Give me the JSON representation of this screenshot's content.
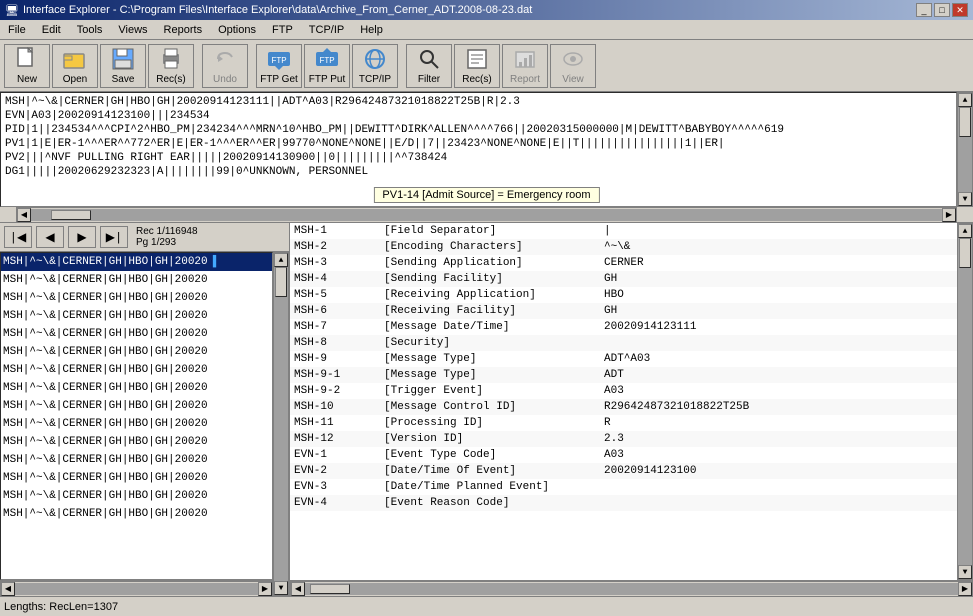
{
  "window": {
    "title": "Interface Explorer - C:\\Program Files\\Interface Explorer\\data\\Archive_From_Cerner_ADT.2008-08-23.dat",
    "icon": "🖥"
  },
  "menu": {
    "items": [
      "File",
      "Edit",
      "Tools",
      "Views",
      "Reports",
      "Options",
      "FTP",
      "TCP/IP",
      "Help"
    ]
  },
  "toolbar": {
    "buttons": [
      {
        "label": "New",
        "icon": "📄",
        "name": "new-button"
      },
      {
        "label": "Open",
        "icon": "📂",
        "name": "open-button"
      },
      {
        "label": "Save",
        "icon": "💾",
        "name": "save-button"
      },
      {
        "label": "Rec(s)",
        "icon": "🖨",
        "name": "recs-print-button"
      },
      {
        "label": "Undo",
        "icon": "↩",
        "name": "undo-button",
        "disabled": true
      },
      {
        "label": "FTP Get",
        "icon": "⬇",
        "name": "ftp-get-button"
      },
      {
        "label": "FTP Put",
        "icon": "⬆",
        "name": "ftp-put-button"
      },
      {
        "label": "TCP/IP",
        "icon": "🌐",
        "name": "tcpip-button"
      },
      {
        "label": "Filter",
        "icon": "🔍",
        "name": "filter-button"
      },
      {
        "label": "Rec(s)",
        "icon": "📋",
        "name": "recs-button"
      },
      {
        "label": "Report",
        "icon": "📊",
        "name": "report-button",
        "disabled": true
      },
      {
        "label": "View",
        "icon": "👁",
        "name": "view-button",
        "disabled": true
      }
    ]
  },
  "text_area": {
    "lines": [
      "MSH|^~\\&|CERNER|GH|HBO|GH|20020914123111||ADT^A03|R29642487321018822T25B|R|2.3",
      "EVN|A03|20020914123100|||234534",
      "PID|1||234534^^^CPI^2^HBO_PM|234234^^^MRN^10^HBO_PM||DEWITT^DIRK^ALLEN^^^^766||20020315000000|M|DEWITT^BABYBOY^^^^^619",
      "PV1|1|E|ER-1^^^ER^^772^ER|E|ER-1^^^ER^^ER|99770^NONE^NONE||E/D||7||23423^NONE^NONE|E||T||||||||||||||||1||ER|",
      "PV2|||^NVF PULLING RIGHT EAR|||||20020914130900||0|||||||||^^738424",
      "DG1|||||20020629232323|A||||||||99|0^UNKNOWN, PERSONNEL"
    ],
    "tooltip": "PV1-14 [Admit Source] = Emergency room"
  },
  "nav": {
    "record_info": "Rec 1/116948",
    "page_info": "Pg 1/293"
  },
  "record_list": {
    "items": [
      "MSH|^~\\&|CERNER|GH|HBO|GH|20020",
      "MSH|^~\\&|CERNER|GH|HBO|GH|20020",
      "MSH|^~\\&|CERNER|GH|HBO|GH|20020",
      "MSH|^~\\&|CERNER|GH|HBO|GH|20020",
      "MSH|^~\\&|CERNER|GH|HBO|GH|20020",
      "MSH|^~\\&|CERNER|GH|HBO|GH|20020",
      "MSH|^~\\&|CERNER|GH|HBO|GH|20020",
      "MSH|^~\\&|CERNER|GH|HBO|GH|20020",
      "MSH|^~\\&|CERNER|GH|HBO|GH|20020",
      "MSH|^~\\&|CERNER|GH|HBO|GH|20020",
      "MSH|^~\\&|CERNER|GH|HBO|GH|20020",
      "MSH|^~\\&|CERNER|GH|HBO|GH|20020",
      "MSH|^~\\&|CERNER|GH|HBO|GH|20020",
      "MSH|^~\\&|CERNER|GH|HBO|GH|20020",
      "MSH|^~\\&|CERNER|GH|HBO|GH|20020"
    ]
  },
  "fields": [
    {
      "name": "MSH-1",
      "desc": "[Field Separator]",
      "value": "|"
    },
    {
      "name": "MSH-2",
      "desc": "[Encoding Characters]",
      "value": "^~\\&"
    },
    {
      "name": "MSH-3",
      "desc": "[Sending Application]",
      "value": "CERNER"
    },
    {
      "name": "MSH-4",
      "desc": "[Sending Facility]",
      "value": "GH"
    },
    {
      "name": "MSH-5",
      "desc": "[Receiving Application]",
      "value": "HBO"
    },
    {
      "name": "MSH-6",
      "desc": "[Receiving Facility]",
      "value": "GH"
    },
    {
      "name": "MSH-7",
      "desc": "[Message Date/Time]",
      "value": "20020914123111"
    },
    {
      "name": "MSH-8",
      "desc": "[Security]",
      "value": ""
    },
    {
      "name": "MSH-9",
      "desc": "[Message Type]",
      "value": "ADT^A03"
    },
    {
      "name": "MSH-9-1",
      "desc": "[Message Type]",
      "value": "ADT"
    },
    {
      "name": "MSH-9-2",
      "desc": "[Trigger Event]",
      "value": "A03"
    },
    {
      "name": "MSH-10",
      "desc": "[Message Control ID]",
      "value": "R29642487321018822T25B"
    },
    {
      "name": "MSH-11",
      "desc": "[Processing ID]",
      "value": "R"
    },
    {
      "name": "MSH-12",
      "desc": "[Version ID]",
      "value": "2.3"
    },
    {
      "name": "EVN-1",
      "desc": "[Event Type Code]",
      "value": "A03"
    },
    {
      "name": "EVN-2",
      "desc": "[Date/Time Of Event]",
      "value": "20020914123100"
    },
    {
      "name": "EVN-3",
      "desc": "[Date/Time Planned Event]",
      "value": ""
    },
    {
      "name": "EVN-4",
      "desc": "[Event Reason Code]",
      "value": ""
    }
  ],
  "status_bar": {
    "text": "Lengths: RecLen=1307"
  }
}
